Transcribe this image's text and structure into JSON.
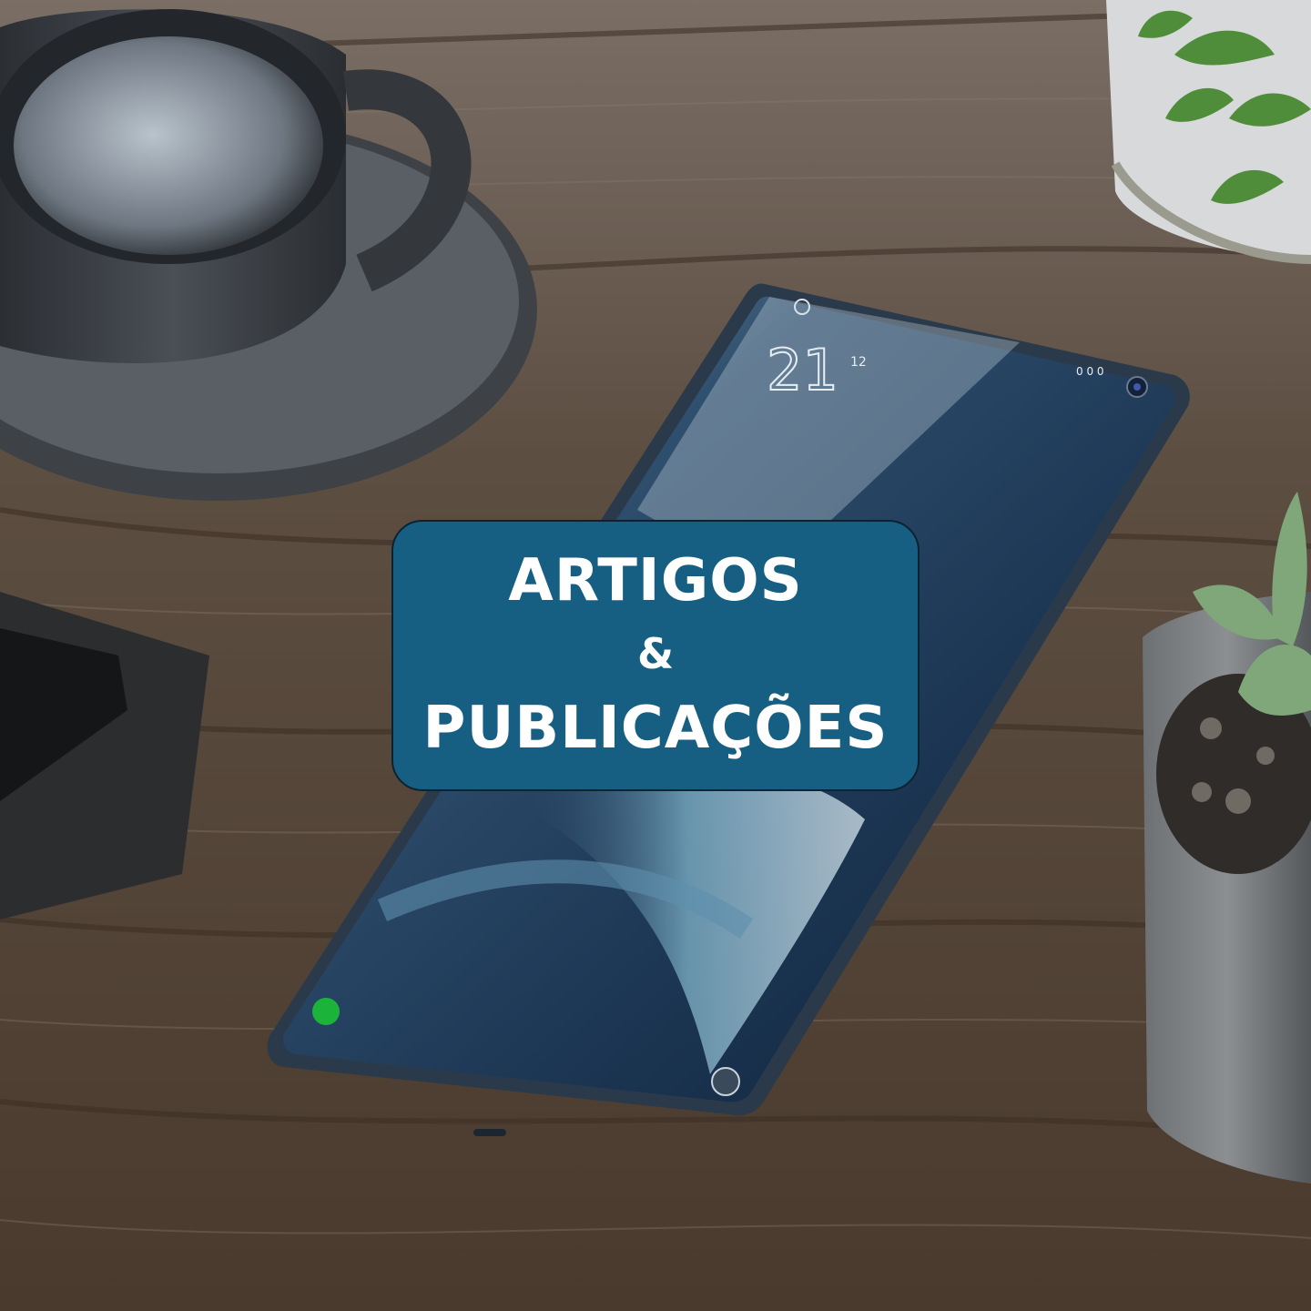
{
  "banner": {
    "line1": "ARTIGOS",
    "line2": "&",
    "line3": "PUBLICAÇÕES",
    "background": "#175f82",
    "text_color": "#ffffff"
  },
  "phone_screen": {
    "clock_text": "21",
    "clock_small": "12",
    "status_text": "0 0 0"
  },
  "scene": {
    "objects": [
      "coffee-cup",
      "saucer",
      "smartphone",
      "potted-plant",
      "succulent-pot",
      "notebook",
      "wooden-table"
    ],
    "colors": {
      "wood": "#5b4a3b",
      "screen": "#1d3a57",
      "accent_green": "#1bb33a"
    }
  }
}
